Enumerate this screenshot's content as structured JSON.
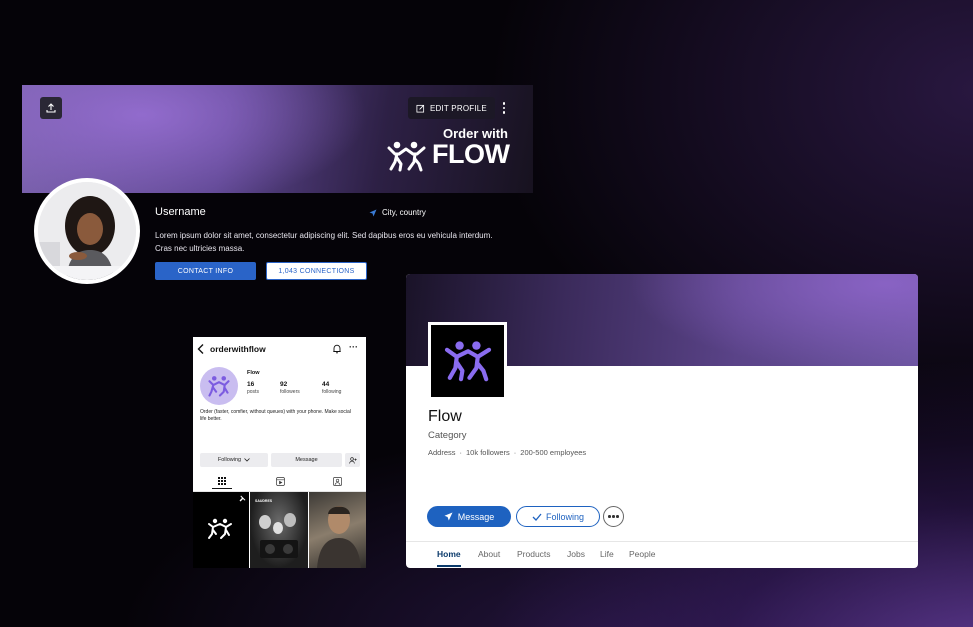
{
  "profile_card": {
    "edit_profile_label": "EDIT PROFILE",
    "brand_tagline": "Order with",
    "brand_word": "FLOW",
    "username": "Username",
    "location": "City, country",
    "bio": "Lorem ipsum dolor sit amet, consectetur adipiscing elit. Sed dapibus eros eu vehicula interdum. Cras nec ultricies massa.",
    "contact_info_label": "CONTACT INFO",
    "connections_label": "1,043 CONNECTIONS",
    "icons": [
      "upload-icon",
      "edit-icon",
      "more-vertical-icon",
      "location-arrow-icon"
    ]
  },
  "phone_profile": {
    "handle": "orderwithflow",
    "name": "Flow",
    "stats": [
      {
        "value": "16",
        "label": "posts"
      },
      {
        "value": "92",
        "label": "followers"
      },
      {
        "value": "44",
        "label": "following"
      }
    ],
    "bio": "Order (faster, comfier, without queues) with your phone. Make social life better.",
    "following_label": "Following",
    "message_label": "Message",
    "tabs": [
      "grid-icon",
      "reels-icon",
      "tagged-icon"
    ],
    "post_caption": "SAUDRES",
    "icons": [
      "back-arrow-icon",
      "bell-icon",
      "more-horizontal-icon",
      "add-user-icon",
      "pin-icon"
    ]
  },
  "company_card": {
    "name": "Flow",
    "category": "Category",
    "meta": [
      "Address",
      "·",
      "10k followers",
      "·",
      "200-500 employees"
    ],
    "message_label": "Message",
    "following_label": "Following",
    "tabs": [
      "Home",
      "About",
      "Products",
      "Jobs",
      "Life",
      "People"
    ],
    "active_tab": "Home"
  },
  "colors": {
    "accent_blue": "#2a64c8",
    "linkedin_blue": "#1e62c0",
    "brand_purple": "#6c55a0",
    "logo_lavender": "#8a6cf0"
  }
}
